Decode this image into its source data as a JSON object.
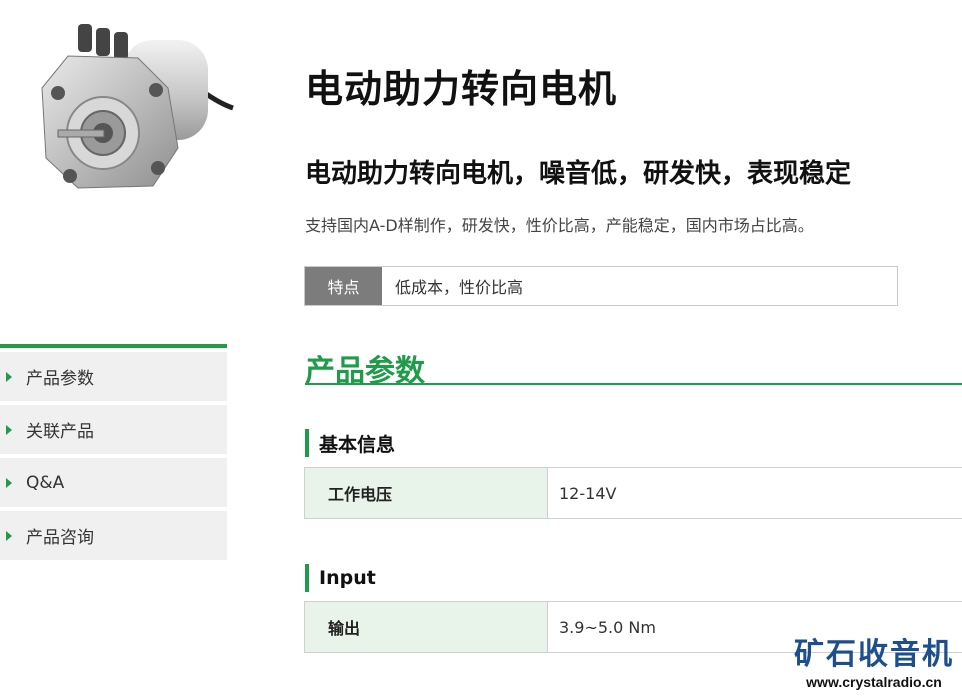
{
  "product": {
    "title": "电动助力转向电机",
    "subtitle": "电动助力转向电机，噪音低，研发快，表现稳定",
    "description": "支持国内A-D样制作，研发快，性价比高，产能稳定，国内市场占比高。",
    "feature": {
      "tag": "特点",
      "value": "低成本，性价比高"
    }
  },
  "sidenav": {
    "accent": "#1f9b4a",
    "items": [
      {
        "label": "产品参数"
      },
      {
        "label": "关联产品"
      },
      {
        "label": "Q&A"
      },
      {
        "label": "产品咨询"
      }
    ]
  },
  "specs": {
    "heading": "产品参数",
    "groups": [
      {
        "title": "基本信息",
        "rows": [
          {
            "key": "工作电压",
            "value": "12-14V"
          }
        ]
      },
      {
        "title": "Input",
        "rows": [
          {
            "key": "输出",
            "value": "3.9~5.0 Nm"
          }
        ]
      }
    ]
  },
  "watermark": {
    "name": "矿石收音机",
    "url": "www.crystalradio.cn"
  }
}
